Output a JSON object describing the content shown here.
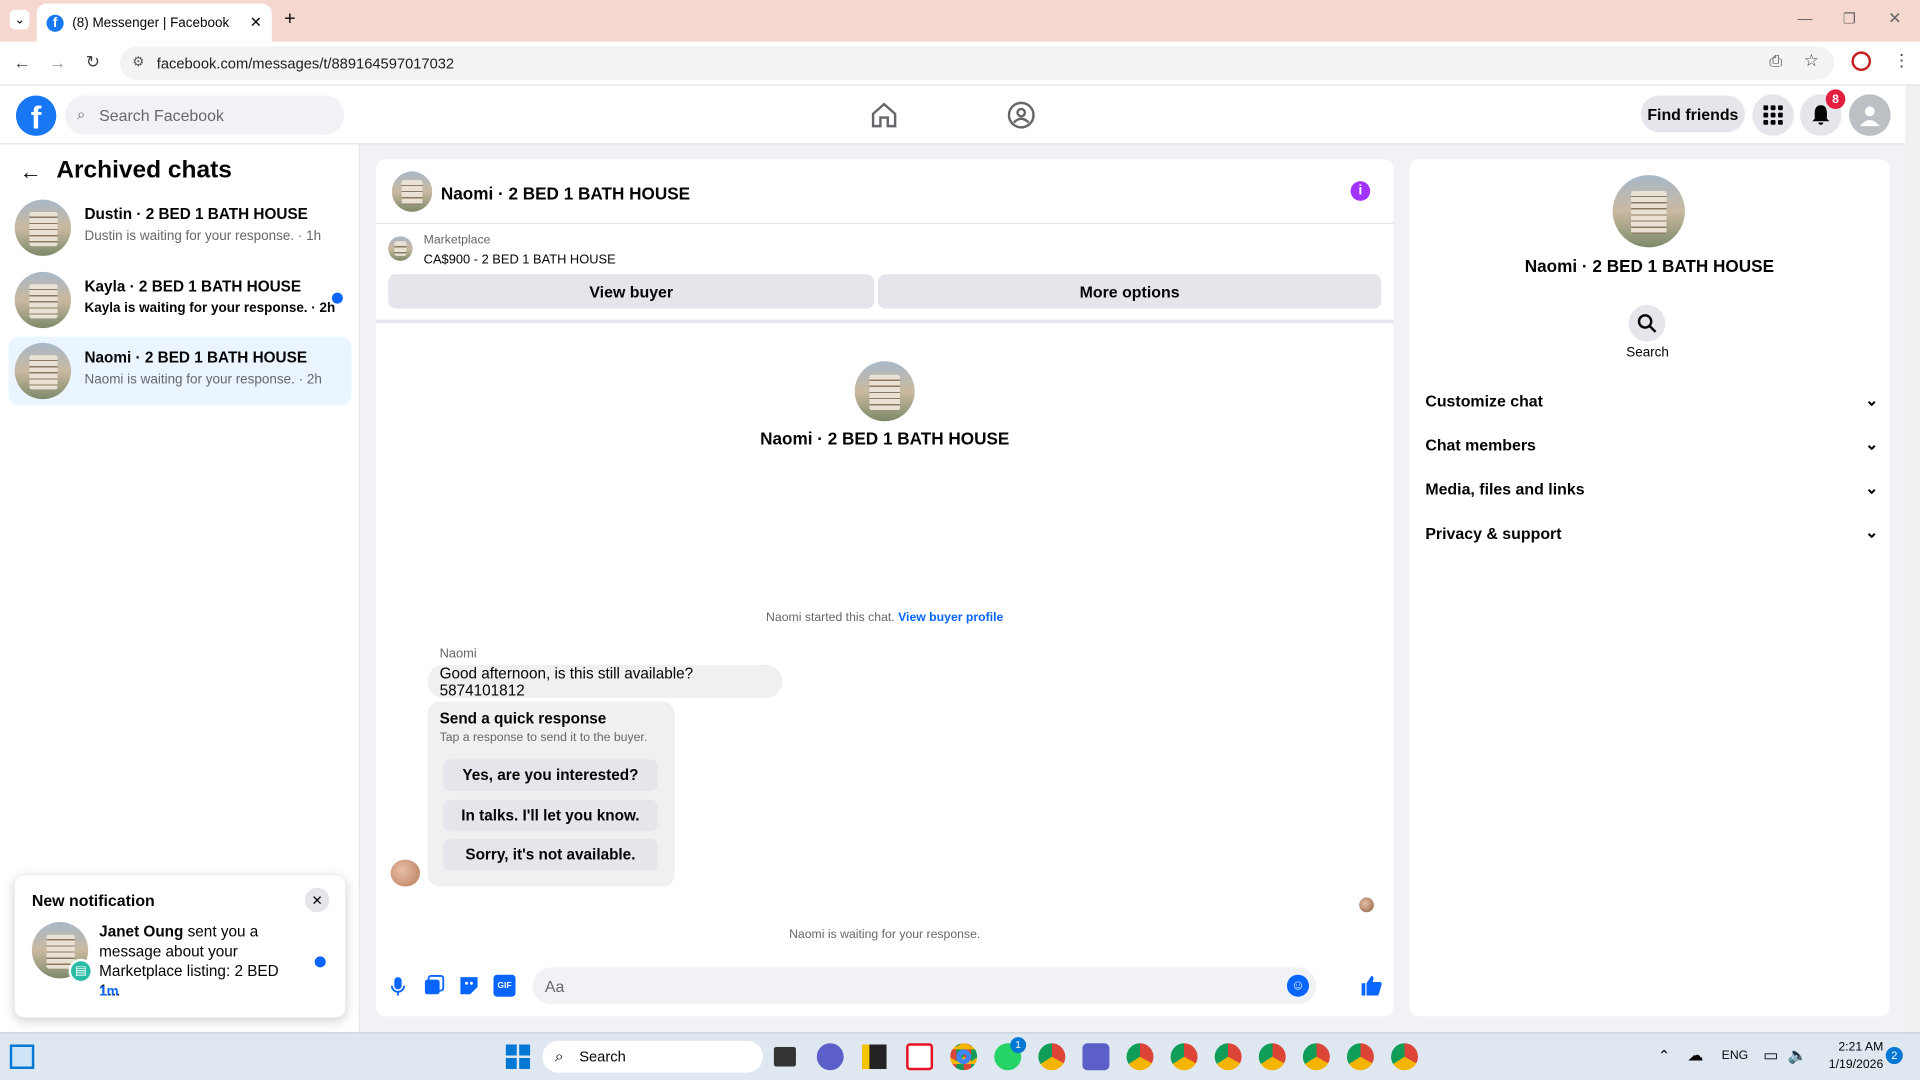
{
  "browser": {
    "tab_title": "(8) Messenger | Facebook",
    "url": "facebook.com/messages/t/889164597017032"
  },
  "fb": {
    "logo": "f",
    "search_placeholder": "Search Facebook",
    "find_friends": "Find friends",
    "notif_count": "8"
  },
  "left": {
    "title": "Archived chats",
    "chats": [
      {
        "name": "Dustin · 2 BED 1 BATH HOUSE",
        "preview": "Dustin is waiting for your response. · 1h",
        "unread": false
      },
      {
        "name": "Kayla · 2 BED 1 BATH HOUSE",
        "preview": "Kayla is waiting for your response. · 2h",
        "unread": true
      },
      {
        "name": "Naomi · 2 BED 1 BATH HOUSE",
        "preview": "Naomi is waiting for your response. · 2h",
        "unread": false
      }
    ]
  },
  "notification": {
    "heading": "New notification",
    "sender": "Janet Oung",
    "text": " sent you a message about your Marketplace listing: ",
    "listing": "2 BED 1...",
    "time": "1m"
  },
  "conversation": {
    "title": "Naomi · 2 BED 1 BATH HOUSE",
    "marketplace_label": "Marketplace",
    "listing": "CA$900 - 2 BED 1 BATH HOUSE",
    "view_buyer": "View buyer",
    "more_options": "More options",
    "intro_name": "Naomi · 2 BED 1 BATH HOUSE",
    "started_text": "Naomi started this chat. ",
    "buyer_profile_link": "View buyer profile",
    "sender_label": "Naomi",
    "message": "Good afternoon, is this still available? 5874101812",
    "quick_title": "Send a quick response",
    "quick_sub": "Tap a response to send it to the buyer.",
    "quick_replies": [
      "Yes, are you interested?",
      "In talks. I'll let you know.",
      "Sorry, it's not available."
    ],
    "waiting": "Naomi is waiting for your response.",
    "composer_placeholder": "Aa"
  },
  "details": {
    "name": "Naomi · 2 BED 1 BATH HOUSE",
    "search_label": "Search",
    "sections": [
      "Customize chat",
      "Chat members",
      "Media, files and links",
      "Privacy & support"
    ]
  },
  "taskbar": {
    "search": "Search",
    "lang": "ENG",
    "time": "2:21 AM",
    "date": "1/19/2026",
    "badge": "2",
    "teams_badge": "1"
  },
  "colors": {
    "brand": "#1877f2",
    "link": "#0866ff",
    "badge": "#e41e3f",
    "info": "#a033ff"
  }
}
